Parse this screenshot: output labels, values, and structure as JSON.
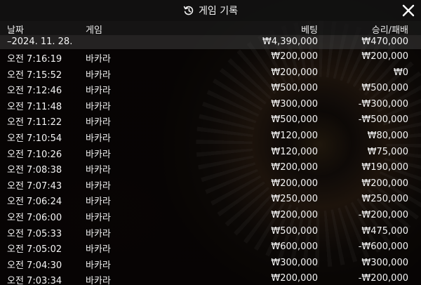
{
  "header": {
    "title": "게임 기록",
    "history_icon": "history-icon",
    "close_icon": "close-icon"
  },
  "columns": {
    "date": "날짜",
    "game": "게임",
    "bet": "베팅",
    "result": "승리/패배"
  },
  "summary": {
    "date": "–2024. 11. 28.",
    "bet": "₩4,390,000",
    "result": "₩470,000"
  },
  "rows": [
    {
      "time": "오전 7:16:19",
      "game": "바카라",
      "bet": "₩200,000",
      "result": "₩200,000"
    },
    {
      "time": "오전 7:15:52",
      "game": "바카라",
      "bet": "₩200,000",
      "result": "₩0"
    },
    {
      "time": "오전 7:12:46",
      "game": "바카라",
      "bet": "₩500,000",
      "result": "₩500,000"
    },
    {
      "time": "오전 7:11:48",
      "game": "바카라",
      "bet": "₩300,000",
      "result": "-₩300,000"
    },
    {
      "time": "오전 7:11:22",
      "game": "바카라",
      "bet": "₩500,000",
      "result": "-₩500,000"
    },
    {
      "time": "오전 7:10:54",
      "game": "바카라",
      "bet": "₩120,000",
      "result": "₩80,000"
    },
    {
      "time": "오전 7:10:26",
      "game": "바카라",
      "bet": "₩120,000",
      "result": "₩75,000"
    },
    {
      "time": "오전 7:08:38",
      "game": "바카라",
      "bet": "₩200,000",
      "result": "₩190,000"
    },
    {
      "time": "오전 7:07:43",
      "game": "바카라",
      "bet": "₩200,000",
      "result": "₩200,000"
    },
    {
      "time": "오전 7:06:24",
      "game": "바카라",
      "bet": "₩250,000",
      "result": "₩250,000"
    },
    {
      "time": "오전 7:06:00",
      "game": "바카라",
      "bet": "₩200,000",
      "result": "-₩200,000"
    },
    {
      "time": "오전 7:05:33",
      "game": "바카라",
      "bet": "₩500,000",
      "result": "₩475,000"
    },
    {
      "time": "오전 7:05:02",
      "game": "바카라",
      "bet": "₩600,000",
      "result": "-₩600,000"
    },
    {
      "time": "오전 7:04:30",
      "game": "바카라",
      "bet": "₩300,000",
      "result": "₩300,000"
    },
    {
      "time": "오전 7:03:34",
      "game": "바카라",
      "bet": "₩200,000",
      "result": "-₩200,000"
    }
  ]
}
